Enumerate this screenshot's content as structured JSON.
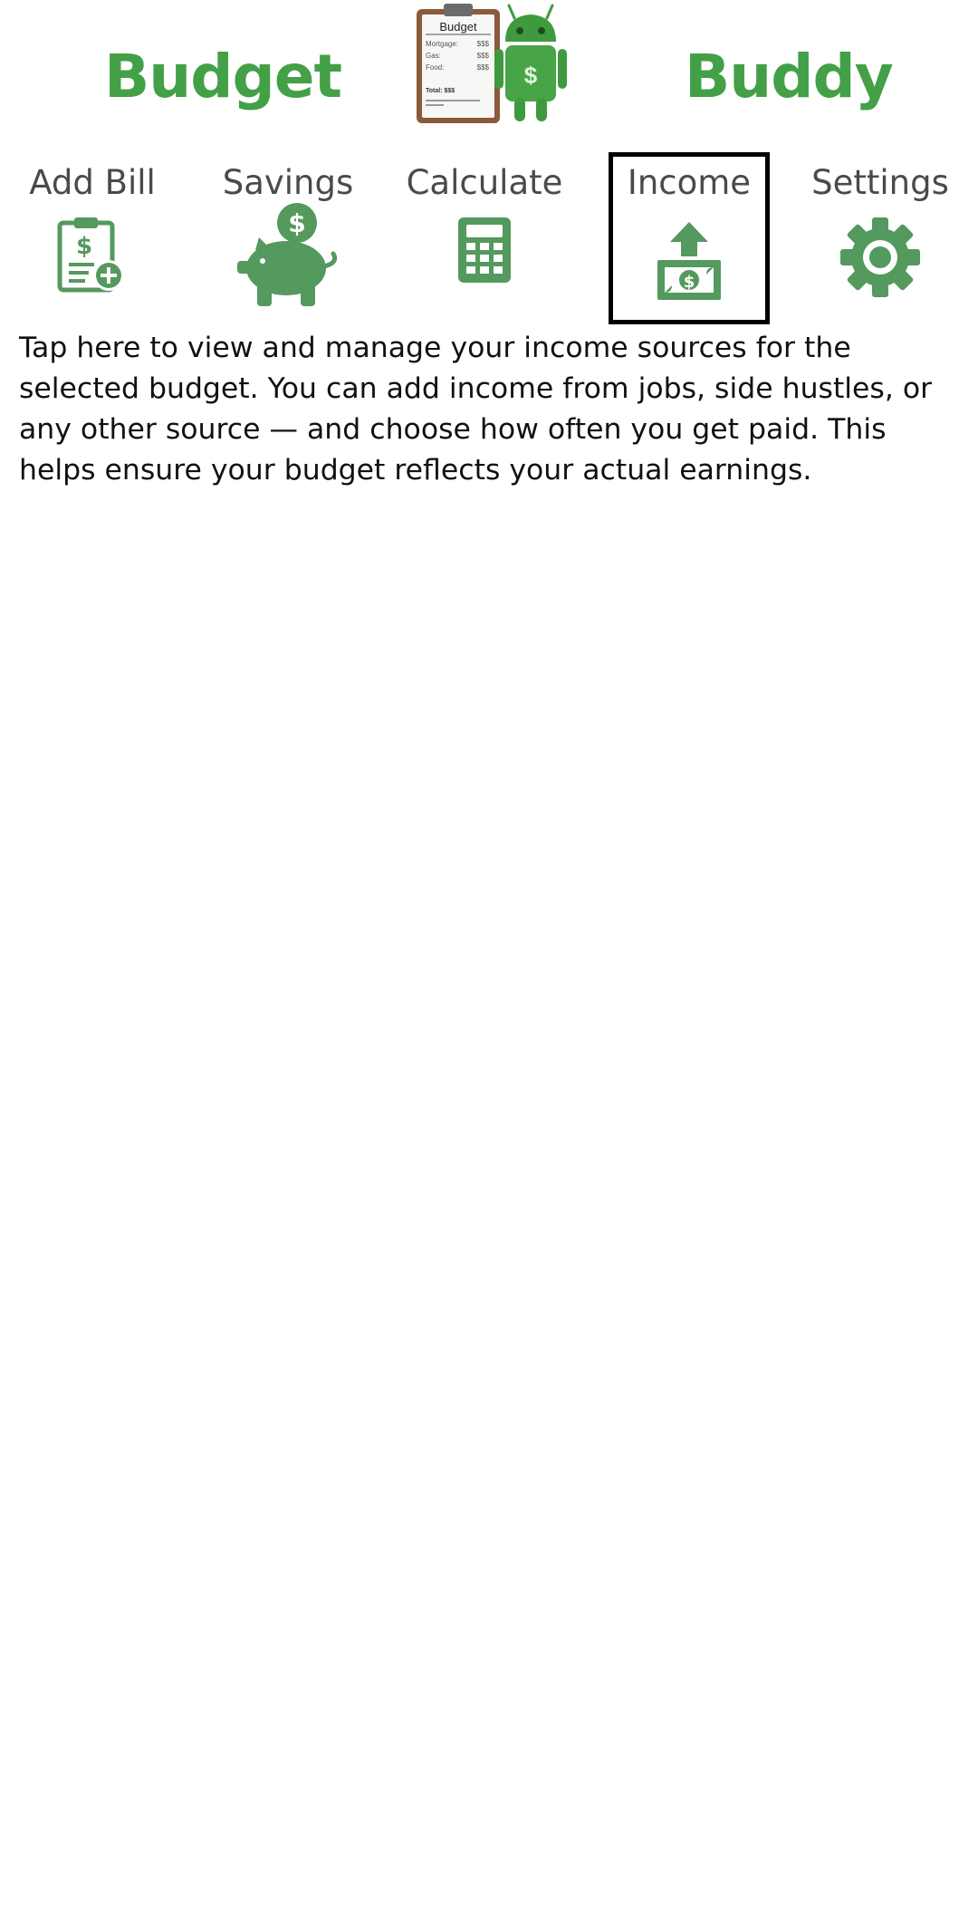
{
  "app": {
    "title_left": "Budget",
    "title_right": "Buddy",
    "logo": {
      "icon": "budget-clipboard-android-logo",
      "board_title": "Budget",
      "rows": [
        {
          "label": "Mortgage:",
          "value": "$$$"
        },
        {
          "label": "Gas:",
          "value": "$$$"
        },
        {
          "label": "Food:",
          "value": "$$$"
        }
      ],
      "total": "Total: $$$",
      "robot_badge": "$"
    }
  },
  "colors": {
    "brand": "#43a047",
    "icon_green": "#54995d",
    "label_gray": "#4a4a4a",
    "selected_border": "#000000"
  },
  "nav": {
    "items": [
      {
        "label": "Add Bill",
        "icon": "clipboard-dollar-add-icon"
      },
      {
        "label": "Savings",
        "icon": "piggy-bank-icon"
      },
      {
        "label": "Calculate",
        "icon": "calculator-icon"
      },
      {
        "label": "Income",
        "icon": "money-upload-icon",
        "selected": true
      },
      {
        "label": "Settings",
        "icon": "gear-icon"
      }
    ]
  },
  "help": {
    "text": "Tap here to view and manage your income sources for the selected budget. You can add income from jobs, side hustles, or any other source — and choose how often you get paid. This helps ensure your budget reflects your actual earnings."
  }
}
